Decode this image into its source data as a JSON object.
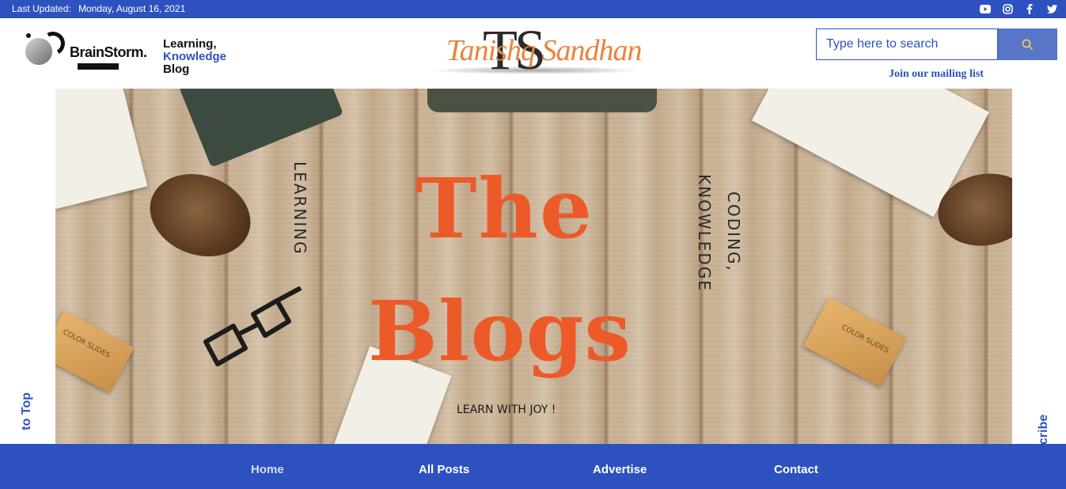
{
  "topbar": {
    "updated_label": "Last Updated:",
    "updated_date": "Monday, August 16, 2021",
    "social": [
      "youtube-icon",
      "instagram-icon",
      "facebook-icon",
      "twitter-icon"
    ]
  },
  "header": {
    "brand_name": "BrainStorm.",
    "tagline": {
      "line1": "Learning,",
      "line2": "Knowledge",
      "line3": "Blog"
    },
    "logo_letters": "TS",
    "logo_script": "Tanishq Sandhan"
  },
  "search": {
    "placeholder": "Type here to search",
    "button_icon": "search-icon"
  },
  "mailing_link": "Join our mailing list",
  "hero": {
    "title_line1": "The",
    "title_line2": "Blogs",
    "left_vertical": "LEARNING",
    "right_vertical_1": "CODING,",
    "right_vertical_2": "KNOWLEDGE",
    "subtitle": "LEARN WITH JOY !",
    "box_label": "COLOR SLIDES"
  },
  "side_tabs": {
    "left": "to Top",
    "right": "cribe"
  },
  "nav": {
    "items": [
      "Home",
      "All Posts",
      "Advertise",
      "Contact"
    ],
    "active": "Home"
  },
  "colors": {
    "brand_blue": "#2d52bf",
    "title_orange": "#ec5a2a",
    "logo_orange": "#e8843e"
  }
}
